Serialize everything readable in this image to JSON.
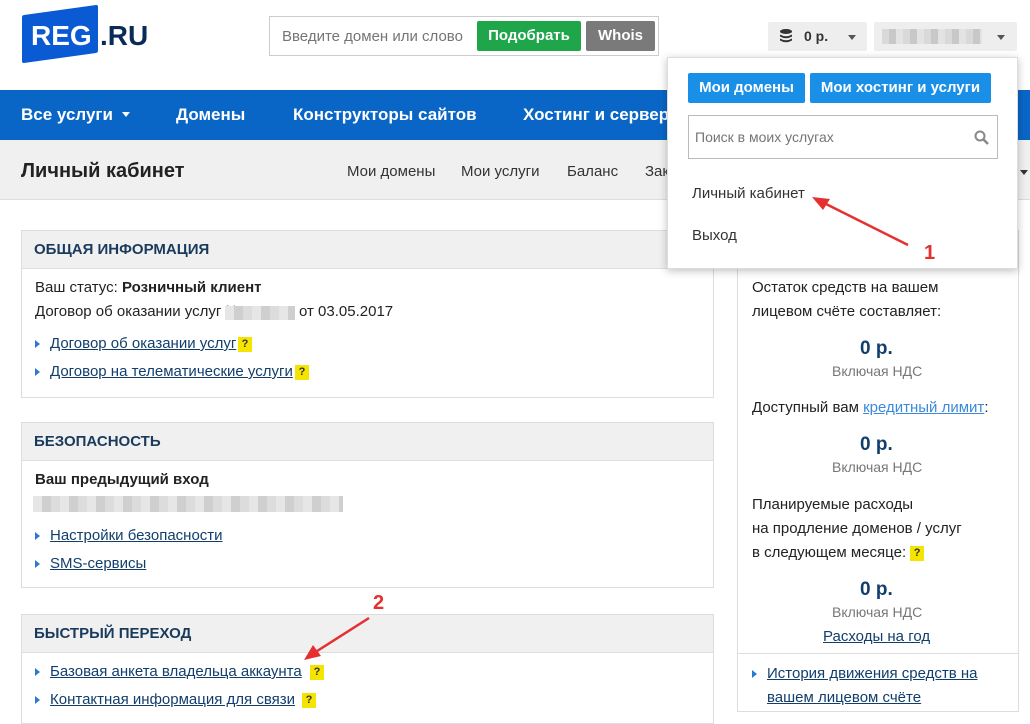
{
  "header": {
    "logo_main": "REG",
    "logo_ru": ".RU",
    "search_placeholder": "Введите домен или слово",
    "pick_button": "Подобрать",
    "whois_button": "Whois",
    "balance": "0 р."
  },
  "nav": {
    "items": [
      "Все услуги",
      "Домены",
      "Конструкторы сайтов",
      "Хостинг и серверы"
    ]
  },
  "subnav": {
    "title": "Личный кабинет",
    "items": [
      "Мои домены",
      "Мои услуги",
      "Баланс",
      "Зак"
    ]
  },
  "general": {
    "title": "ОБЩАЯ ИНФОРМАЦИЯ",
    "status_label": "Ваш статус:",
    "status_value": "Розничный клиент",
    "contract_prefix": "Договор об оказании услуг №",
    "contract_suffix": "от 03.05.2017",
    "links": [
      "Договор об оказании услуг",
      "Договор на телематические услуги"
    ]
  },
  "security": {
    "title": "БЕЗОПАСНОСТЬ",
    "prev_login": "Ваш предыдущий вход",
    "links": [
      "Настройки безопасности",
      "SMS-сервисы"
    ]
  },
  "quick": {
    "title": "БЫСТРЫЙ ПЕРЕХОД",
    "links": [
      "Базовая анкета владельца аккаунта",
      "Контактная информация для связи"
    ]
  },
  "balance_col": {
    "remaining_line1": "Остаток средств на вашем",
    "remaining_line2": "лицевом счёте составляет:",
    "amount1": "0 р.",
    "vat": "Включая НДС",
    "credit_prefix": "Доступный вам",
    "credit_link": "кредитный лимит",
    "credit_suffix": ":",
    "amount2": "0 р.",
    "planned_line1": "Планируемые расходы",
    "planned_line2": "на продление доменов / услуг",
    "planned_line3": "в следующем месяце:",
    "amount3": "0 р.",
    "year_link": "Расходы на год",
    "history_line1": "История движения средств на",
    "history_line2": "вашем лицевом счёте"
  },
  "dropdown": {
    "btn_domains": "Мои домены",
    "btn_hosting": "Мои хостинг и услуги",
    "search_placeholder": "Поиск в моих услугах",
    "cabinet": "Личный кабинет",
    "logout": "Выход"
  },
  "annotations": {
    "one": "1",
    "two": "2"
  },
  "help_mark": "?",
  "colors": {
    "brand_blue": "#0a66c6",
    "green": "#1fa64a",
    "annotation_red": "#e53030"
  }
}
